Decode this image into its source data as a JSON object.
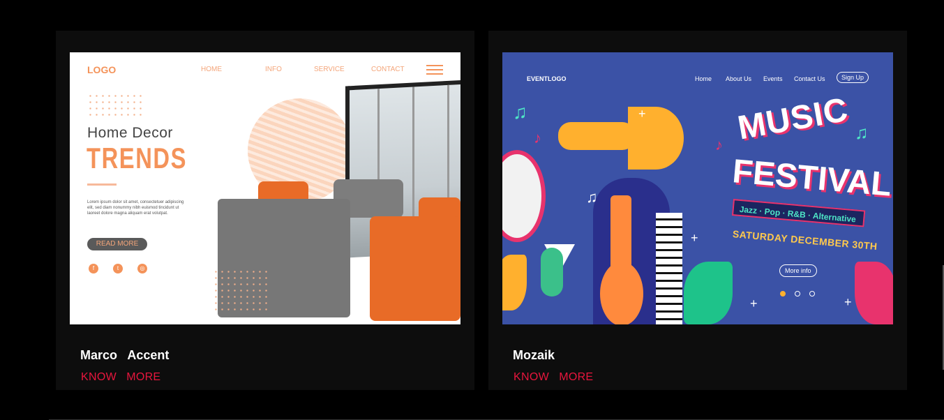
{
  "cards": [
    {
      "title": "Marco   Accent",
      "link": "KNOW   MORE",
      "preview": {
        "logo": "LOGO",
        "nav": [
          "HOME",
          "INFO",
          "SERVICE",
          "CONTACT"
        ],
        "heading_1": "Home  Decor",
        "heading_2": "TRENDS",
        "body": "Lorem ipsum dolor sit amet, consectetuer adipiscing elit, sed diam nonummy nibh euismod tincidunt ut laoreet dolore magna aliquam erat volutpat.",
        "cta": "READ MORE",
        "social_icons": [
          "facebook-icon",
          "twitter-icon",
          "instagram-icon"
        ]
      }
    },
    {
      "title": "Mozaik",
      "link": "KNOW   MORE",
      "preview": {
        "logo": "EVENTLOGO",
        "nav": [
          "Home",
          "About Us",
          "Events",
          "Contact Us"
        ],
        "signup": "Sign Up",
        "heading_1": "MUSIC",
        "heading_2": "FESTIVAL",
        "genres": "Jazz · Pop · R&B · Alternative",
        "date": "SATURDAY DECEMBER 30TH",
        "cta": "More info"
      }
    }
  ],
  "colors": {
    "background": "#000000",
    "card": "#0d0d0d",
    "accent": "#e8163d",
    "title": "#ffffff"
  }
}
